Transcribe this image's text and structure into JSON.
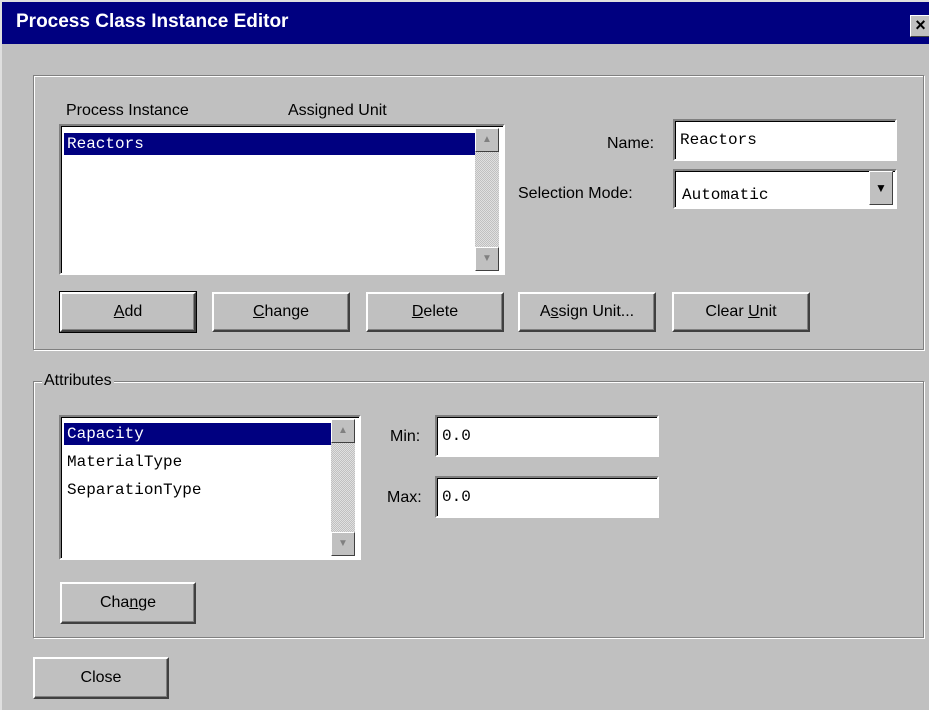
{
  "window": {
    "title": "Process Class Instance Editor",
    "close_glyph": "×"
  },
  "process": {
    "col_instance": "Process Instance",
    "col_unit": "Assigned Unit",
    "items": [
      {
        "name": "Reactors",
        "unit": "",
        "selected": true
      }
    ],
    "name_label": "Name:",
    "name_value": "Reactors",
    "mode_label": "Selection Mode:",
    "mode_value": "Automatic",
    "buttons": {
      "add": {
        "pre": "",
        "key": "A",
        "post": "dd"
      },
      "change": {
        "pre": "",
        "key": "C",
        "post": "hange"
      },
      "delete": {
        "pre": "",
        "key": "D",
        "post": "elete"
      },
      "assign": {
        "pre": "A",
        "key": "s",
        "post": "sign Unit..."
      },
      "clear": {
        "pre": "Clear ",
        "key": "U",
        "post": "nit"
      }
    }
  },
  "attributes": {
    "group_label": "Attributes",
    "items": [
      {
        "name": "Capacity",
        "selected": true
      },
      {
        "name": "MaterialType",
        "selected": false
      },
      {
        "name": "SeparationType",
        "selected": false
      }
    ],
    "min_label": "Min:",
    "min_value": "0.0",
    "max_label": "Max:",
    "max_value": "0.0",
    "change_button": {
      "pre": "Cha",
      "key": "n",
      "post": "ge"
    }
  },
  "footer": {
    "close_label": "Close"
  },
  "icons": {
    "scroll_up": "up-arrow-icon",
    "scroll_down": "down-arrow-icon",
    "dropdown": "chevron-down-icon"
  },
  "colors": {
    "title_bar": "#000080",
    "selection": "#000080",
    "face": "#c0c0c0"
  }
}
